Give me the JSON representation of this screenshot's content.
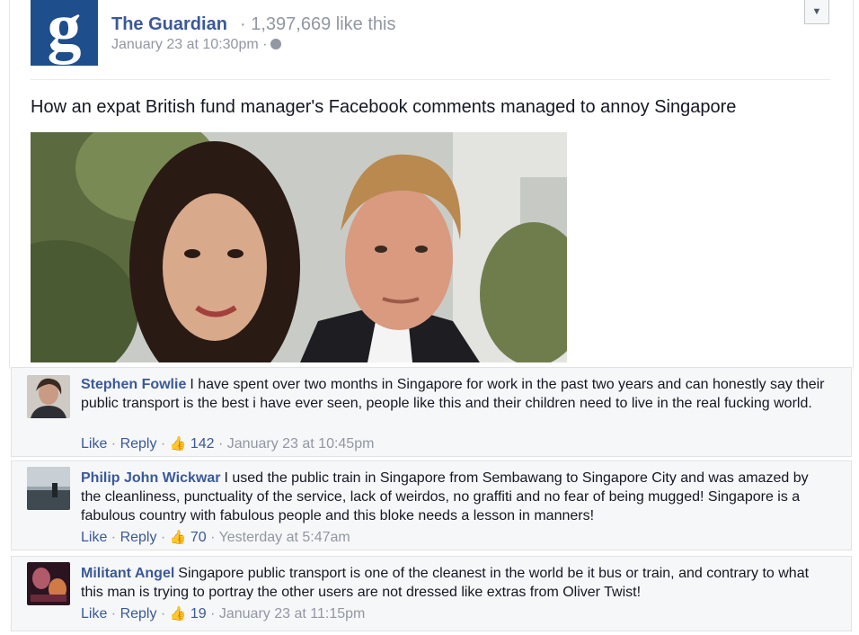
{
  "post": {
    "logo_letter": "g",
    "page_name": "The Guardian",
    "likes_text": "· 1,397,669 like this",
    "timestamp": "January 23 at 10:30pm ·",
    "headline": "How an expat British fund manager's Facebook comments managed to annoy Singapore"
  },
  "icons": {
    "menu": "chevron-down-icon",
    "audience": "globe-icon",
    "like": "thumbs-up-icon"
  },
  "colors": {
    "link": "#3b5998",
    "meta": "#9197a3",
    "guardian_blue": "#1f4e8c",
    "comment_bg": "#f6f7f8"
  },
  "comments": [
    {
      "name": "Stephen Fowlie",
      "text": "I have spent over two months in Singapore for work in the past two years and can honestly say their public transport is the best i have ever seen, people like this and their children need to live in the real fucking world.",
      "like_label": "Like",
      "reply_label": "Reply",
      "likes": "142",
      "time": "January 23 at 10:45pm"
    },
    {
      "name": "Philip John Wickwar",
      "text": "I used the public train in Singapore from Sembawang to Singapore City and was amazed by the cleanliness, punctuality of the service, lack of weirdos, no graffiti and no fear of being mugged! Singapore is a fabulous country with fabulous people and this bloke needs a lesson in manners!",
      "like_label": "Like",
      "reply_label": "Reply",
      "likes": "70",
      "time": "Yesterday at 5:47am"
    },
    {
      "name": "Militant Angel",
      "text": "Singapore public transport is one of the cleanest in the world be it bus or train, and contrary to what this man is trying to portray the other users are not dressed like extras from Oliver Twist!",
      "like_label": "Like",
      "reply_label": "Reply",
      "likes": "19",
      "time": "January 23 at 11:15pm"
    }
  ]
}
